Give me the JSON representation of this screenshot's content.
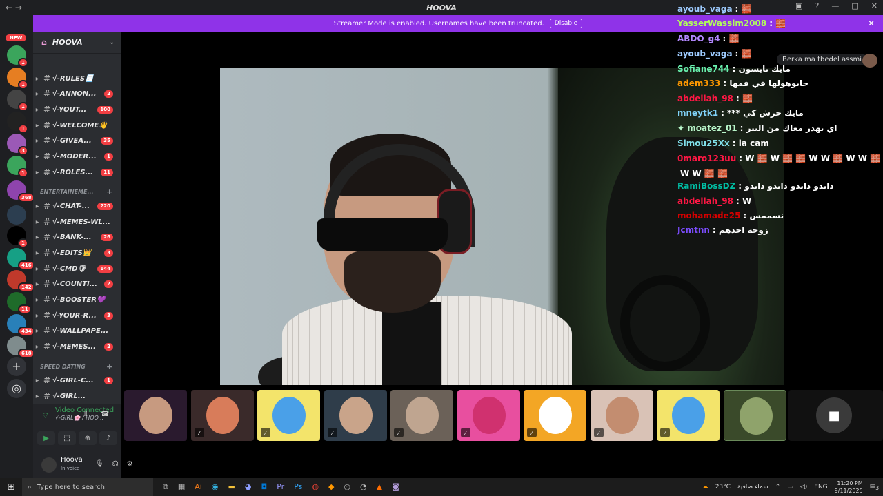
{
  "titlebar": {
    "back": "←",
    "forward": "→",
    "title": "HOOVA"
  },
  "banner": {
    "text": "Streamer Mode is enabled. Usernames have been truncated.",
    "button": "Disable",
    "close": "✕"
  },
  "rail": {
    "new_label": "NEW",
    "servers": [
      {
        "badge": "1",
        "color": "#3ba55c"
      },
      {
        "badge": "1",
        "color": "#e67e22"
      },
      {
        "badge": "1",
        "color": "#444444"
      },
      {
        "badge": "1",
        "color": "#222222"
      },
      {
        "badge": "3",
        "color": "#9b59b6"
      },
      {
        "badge": "1",
        "color": "#3ba55c"
      },
      {
        "badge": "368",
        "color": "#8e44ad"
      },
      {
        "badge": "",
        "color": "#2c3e50"
      },
      {
        "badge": "1",
        "color": "#000000"
      },
      {
        "badge": "416",
        "color": "#16a085"
      },
      {
        "badge": "142",
        "color": "#c0392b"
      },
      {
        "badge": "11",
        "color": "#1f6b2a"
      },
      {
        "badge": "434",
        "color": "#2980b9"
      },
      {
        "badge": "618",
        "color": "#7f8c8d"
      }
    ]
  },
  "sidebar": {
    "server_name": "HOOVA",
    "channels": [
      {
        "name": "√-RULES📃",
        "count": ""
      },
      {
        "name": "√-ANNON...",
        "count": "2"
      },
      {
        "name": "√-YOUT...",
        "count": "100"
      },
      {
        "name": "√-WELCOME👋",
        "count": ""
      },
      {
        "name": "√-GIVEA...",
        "count": "35"
      },
      {
        "name": "√-MODER...",
        "count": "1"
      },
      {
        "name": "√-ROLES...",
        "count": "11"
      }
    ],
    "category_entertainment": "ENTERTAINEME...",
    "channels2": [
      {
        "name": "√-CHAT-...",
        "count": "220"
      },
      {
        "name": "√-MEMES-WL...",
        "count": ""
      },
      {
        "name": "√-BANK-...",
        "count": "26"
      },
      {
        "name": "√-EDITS👑",
        "count": "3"
      },
      {
        "name": "√-CMD🛡",
        "count": "144"
      },
      {
        "name": "√-COUNTI...",
        "count": "2"
      },
      {
        "name": "√-BOOSTER💜",
        "count": ""
      },
      {
        "name": "√-YOUR-R...",
        "count": "3"
      },
      {
        "name": "√-WALLPAPE...",
        "count": ""
      },
      {
        "name": "√-MEMES...",
        "count": "2"
      }
    ],
    "category_speed": "SPEED DATING",
    "channels3": [
      {
        "name": "√-GIRL-C...",
        "count": "1"
      },
      {
        "name": "√-GIRL...",
        "count": ""
      }
    ]
  },
  "voice": {
    "status": "Video Connected",
    "channel": "√-GIRL🌸 / HOO...",
    "user": "Hoova",
    "user_status": "In voice"
  },
  "chat": [
    {
      "user": "ayoub_vaga",
      "color": "#9ecbff",
      "text": "🧱"
    },
    {
      "user": "YasserWassim2008",
      "color": "#b2ff59",
      "text": "🧱"
    },
    {
      "user": "ABDO_g4",
      "color": "#b388ff",
      "text": "🧱"
    },
    {
      "user": "ayoub_vaga",
      "color": "#9ecbff",
      "text": "🧱"
    },
    {
      "user": "Sofiane744",
      "color": "#69f0ae",
      "text": "مايك تايسون"
    },
    {
      "user": "adem333",
      "color": "#ff9800",
      "text": "جابوهولها في فمها"
    },
    {
      "user": "abdellah_98",
      "color": "#ff1744",
      "text": "🧱"
    },
    {
      "user": "mneytk1",
      "color": "#81d4fa",
      "text": "*** مايك حرش كي"
    },
    {
      "user": "✦ moatez_01",
      "color": "#b9f6ca",
      "text": "اي تهدر معاك من البير"
    },
    {
      "user": "Simou25Xx",
      "color": "#80deea",
      "text": "la cam"
    },
    {
      "user": "0maro123uu",
      "color": "#ff1744",
      "text": "W 🧱 W 🧱 🧱 W W 🧱 W W 🧱"
    },
    {
      "user": "",
      "color": "#ffffff",
      "text": "W W 🧱 🧱"
    },
    {
      "user": "RamiBossDZ",
      "color": "#00bfa5",
      "text": "داندو داندو داندو داندو"
    },
    {
      "user": "abdellah_98",
      "color": "#ff1744",
      "text": "W"
    },
    {
      "user": "mohamade25",
      "color": "#d50000",
      "text": "نسممس"
    },
    {
      "user": "Jcmtnn",
      "color": "#7c4dff",
      "text": "زوجة احدهم"
    }
  ],
  "tooltip": "Berka ma tbedel assmi",
  "tiles": [
    {
      "bg": "#2a1a2e",
      "face": "#c79a80",
      "muted": false
    },
    {
      "bg": "#3a2a2a",
      "face": "#d87c5a",
      "muted": true
    },
    {
      "bg": "#f3e46b",
      "face": "#4aa0e8",
      "muted": true
    },
    {
      "bg": "#2f3d4a",
      "face": "#c9a48a",
      "muted": true
    },
    {
      "bg": "#6b6158",
      "face": "#bfa590",
      "muted": true
    },
    {
      "bg": "#e84f9f",
      "face": "#d0316f",
      "muted": true
    },
    {
      "bg": "#f3a625",
      "face": "#ffffff",
      "muted": true
    },
    {
      "bg": "#d9c2b6",
      "face": "#c38d70",
      "muted": true
    },
    {
      "bg": "#f3e46b",
      "face": "#4aa0e8",
      "muted": true
    },
    {
      "bg": "#3a4a2a",
      "face": "#8fa36b",
      "muted": false
    }
  ],
  "taskbar": {
    "search_placeholder": "Type here to search",
    "weather": "23°C",
    "weather_text": "سماء صافية",
    "lang": "ENG",
    "time": "11:20 PM",
    "date": "9/11/2025",
    "notif": "3"
  }
}
